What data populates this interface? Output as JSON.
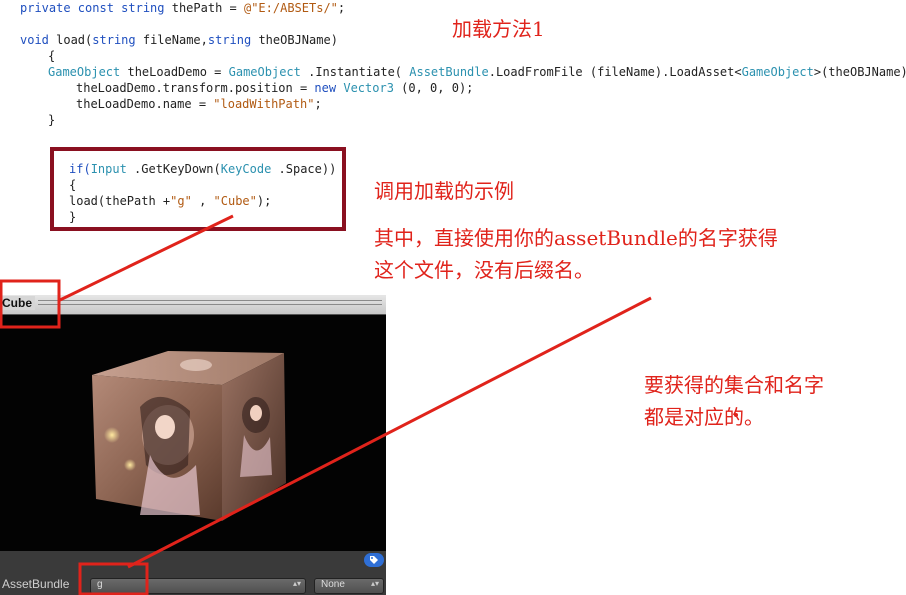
{
  "code": {
    "line1": [
      "private const string",
      " thePath = ",
      "@\"E:/ABSETs/\"",
      ";"
    ],
    "line3": [
      "void",
      " load(",
      "string",
      " fileName,",
      "string",
      " theOBJName)"
    ],
    "line4": "{",
    "line5": [
      "GameObject",
      " theLoadDemo = ",
      "GameObject",
      " .Instantiate( ",
      "AssetBundle",
      ".LoadFromFile (fileName).LoadAsset<",
      "GameObject",
      ">(theOBJName));"
    ],
    "line6": [
      "theLoadDemo.transform.position = ",
      "new",
      " ",
      "Vector3",
      " (0, 0, 0);"
    ],
    "line7": [
      "theLoadDemo.name = ",
      "\"loadWithPath\"",
      ";"
    ],
    "line8": "}"
  },
  "example": {
    "line1": [
      "if(",
      "Input",
      " .GetKeyDown(",
      "KeyCode",
      " .Space))"
    ],
    "line2": "{",
    "line3": [
      "load(thePath +",
      "\"g\"",
      " , ",
      "\"Cube\"",
      ");"
    ],
    "line4": "}"
  },
  "annotations": {
    "method_title": "加载方法1",
    "example_title": "调用加载的示例",
    "note_line1": "其中，直接使用你的assetBundle的名字获得",
    "note_line2": "这个文件，没有后缀名。",
    "match_line1": "要获得的集合和名字",
    "match_line2": "都是对应的。"
  },
  "panel": {
    "title": "Cube",
    "assetbundle_label": "AssetBundle",
    "bundle_value": "g",
    "variant_value": "None",
    "tag_icon": "tag-icon"
  },
  "colors": {
    "annotation_red": "#e0231b",
    "box_border": "#8a1020",
    "keyword_blue": "#1f4fbf",
    "type_teal": "#2b91af",
    "string_brown": "#b15a12"
  }
}
